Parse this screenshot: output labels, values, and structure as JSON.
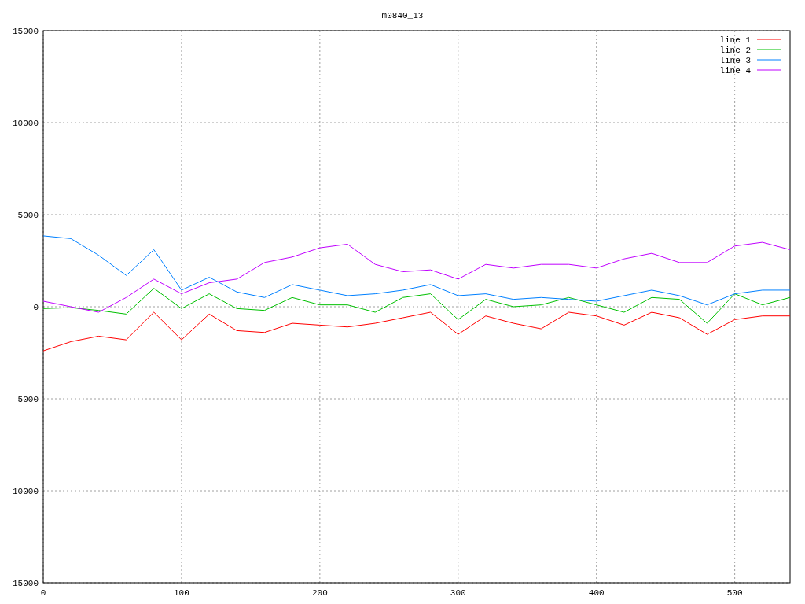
{
  "chart_data": {
    "type": "line",
    "title": "m0840_13",
    "x": [
      0,
      20,
      40,
      60,
      80,
      100,
      120,
      140,
      160,
      180,
      200,
      220,
      240,
      260,
      280,
      300,
      320,
      340,
      360,
      380,
      400,
      420,
      440,
      460,
      480,
      500,
      520,
      540
    ],
    "series": [
      {
        "name": "line 1",
        "color": "#ff0000",
        "values": [
          -2400,
          -1900,
          -1600,
          -1800,
          -300,
          -1800,
          -400,
          -1300,
          -1400,
          -900,
          -1000,
          -1100,
          -900,
          -600,
          -300,
          -1500,
          -500,
          -900,
          -1200,
          -300,
          -500,
          -1000,
          -300,
          -600,
          -1500,
          -700,
          -500,
          -500
        ]
      },
      {
        "name": "line 2",
        "color": "#00c000",
        "values": [
          -100,
          -50,
          -200,
          -400,
          1000,
          -100,
          700,
          -100,
          -200,
          500,
          100,
          100,
          -300,
          500,
          700,
          -700,
          400,
          0,
          100,
          500,
          100,
          -300,
          500,
          400,
          -900,
          700,
          100,
          500
        ]
      },
      {
        "name": "line 3",
        "color": "#0080ff",
        "values": [
          3850,
          3700,
          2800,
          1700,
          3100,
          900,
          1600,
          800,
          500,
          1200,
          900,
          600,
          700,
          900,
          1200,
          600,
          700,
          400,
          500,
          400,
          300,
          600,
          900,
          600,
          100,
          700,
          900,
          900
        ]
      },
      {
        "name": "line 4",
        "color": "#c000ff",
        "values": [
          300,
          0,
          -300,
          500,
          1500,
          700,
          1300,
          1500,
          2400,
          2700,
          3200,
          3400,
          2300,
          1900,
          2000,
          1500,
          2300,
          2100,
          2300,
          2300,
          2100,
          2600,
          2900,
          2400,
          2400,
          3300,
          3500,
          3100
        ]
      }
    ],
    "xlim": [
      0,
      540
    ],
    "ylim": [
      -15000,
      15000
    ],
    "xticks": [
      0,
      100,
      200,
      300,
      400,
      500
    ],
    "yticks": [
      -15000,
      -10000,
      -5000,
      0,
      5000,
      10000,
      15000
    ],
    "grid": true,
    "legend": true
  }
}
